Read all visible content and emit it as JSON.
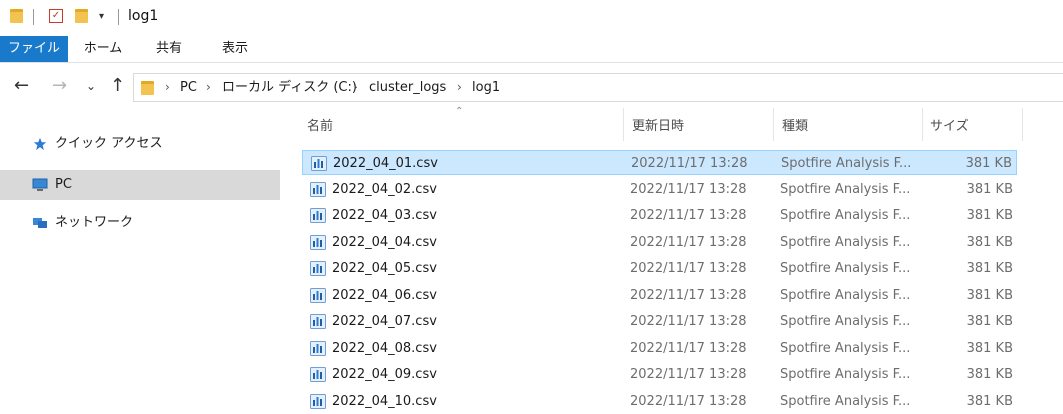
{
  "window": {
    "title": "log1"
  },
  "ribbon": {
    "tabs": [
      {
        "label": "ファイル",
        "active": true
      },
      {
        "label": "ホーム"
      },
      {
        "label": "共有"
      },
      {
        "label": "表示"
      }
    ]
  },
  "address": {
    "crumbs": [
      "PC",
      "ローカル ディスク (C:)",
      "cluster_logs",
      "log1"
    ]
  },
  "nav": {
    "items": [
      {
        "label": "クイック アクセス",
        "icon": "star-icon"
      },
      {
        "label": "PC",
        "icon": "computer-icon",
        "selected": true
      },
      {
        "label": "ネットワーク",
        "icon": "network-icon"
      }
    ]
  },
  "columns": {
    "name": "名前",
    "date": "更新日時",
    "type": "種類",
    "size": "サイズ"
  },
  "files": [
    {
      "name": "2022_04_01.csv",
      "date": "2022/11/17 13:28",
      "type": "Spotfire Analysis F...",
      "size": "381 KB",
      "selected": true
    },
    {
      "name": "2022_04_02.csv",
      "date": "2022/11/17 13:28",
      "type": "Spotfire Analysis F...",
      "size": "381 KB"
    },
    {
      "name": "2022_04_03.csv",
      "date": "2022/11/17 13:28",
      "type": "Spotfire Analysis F...",
      "size": "381 KB"
    },
    {
      "name": "2022_04_04.csv",
      "date": "2022/11/17 13:28",
      "type": "Spotfire Analysis F...",
      "size": "381 KB"
    },
    {
      "name": "2022_04_05.csv",
      "date": "2022/11/17 13:28",
      "type": "Spotfire Analysis F...",
      "size": "381 KB"
    },
    {
      "name": "2022_04_06.csv",
      "date": "2022/11/17 13:28",
      "type": "Spotfire Analysis F...",
      "size": "381 KB"
    },
    {
      "name": "2022_04_07.csv",
      "date": "2022/11/17 13:28",
      "type": "Spotfire Analysis F...",
      "size": "381 KB"
    },
    {
      "name": "2022_04_08.csv",
      "date": "2022/11/17 13:28",
      "type": "Spotfire Analysis F...",
      "size": "381 KB"
    },
    {
      "name": "2022_04_09.csv",
      "date": "2022/11/17 13:28",
      "type": "Spotfire Analysis F...",
      "size": "381 KB"
    },
    {
      "name": "2022_04_10.csv",
      "date": "2022/11/17 13:28",
      "type": "Spotfire Analysis F...",
      "size": "381 KB"
    }
  ],
  "colors": {
    "accent": "#1979ca",
    "selection": "#cce8ff",
    "selection_border": "#99d1ff",
    "nav_selected": "#d9d9d9"
  }
}
